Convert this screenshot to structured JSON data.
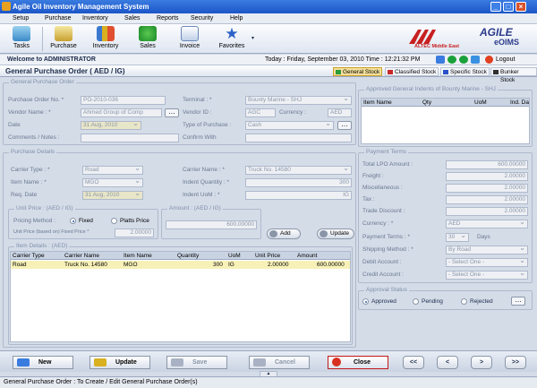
{
  "window": {
    "title": "Agile Oil Inventory Management System"
  },
  "menu": [
    "Setup",
    "Purchase",
    "Inventory",
    "Sales",
    "Reports",
    "Security",
    "Help"
  ],
  "toolbar": {
    "tasks": "Tasks",
    "purchase": "Purchase",
    "inventory": "Inventory",
    "sales": "Sales",
    "invoice": "Invoice",
    "favorites": "Favorites"
  },
  "branding": {
    "altec": "ALTEC Middle East",
    "agile": "AGILE",
    "eoims": "eOIMS",
    "logout": "Logout"
  },
  "welcome": {
    "user": "Welcome to ADMINISTRATOR",
    "datetime": "Today : Friday, September 03, 2010  Time : 12:21:32 PM"
  },
  "page": {
    "title": "General Purchase Order ( AED / IG)"
  },
  "stock_tabs": [
    {
      "label": "General Stock",
      "color": "#2a9a3a"
    },
    {
      "label": "Classified Stock",
      "color": "#c82828"
    },
    {
      "label": "Specific Stock",
      "color": "#2a50c8"
    },
    {
      "label": "Bunker Stock",
      "color": "#303030"
    }
  ],
  "gpo": {
    "section": "General Purchase Order",
    "po_no_label": "Purchase Order No. *",
    "po_no": "PO-2010-036",
    "vendor_name_label": "Vendor Name : *",
    "vendor_name": "Ahmed Group of Comp",
    "date_label": "Date",
    "date": "31 Aug, 2010",
    "comments_label": "Comments / Notes :",
    "terminal_label": "Terminal : *",
    "terminal": "Bounty Marine - SHJ",
    "vendor_id_label": "Vendor ID :",
    "vendor_id": "AGC",
    "currency_label": "Currency :",
    "currency": "AED",
    "type_label": "Type of Purchase :",
    "type": "Cash",
    "confirm_label": "Confirm With"
  },
  "pd": {
    "section": "Purchase Details",
    "carrier_type_label": "Carrier Type : *",
    "carrier_type": "Road",
    "item_name_label": "Item Name : *",
    "item_name": "MGO",
    "req_date_label": "Req. Date",
    "req_date": "31 Aug, 2010",
    "carrier_name_label": "Carrier Name : *",
    "carrier_name": "Truck No. 14580",
    "indent_qty_label": "Indent Quantity : *",
    "indent_qty": "300",
    "indent_uom_label": "Indent UoM : *",
    "indent_uom": "IG",
    "unit_price_section": "Unit Price : (AED / IG)",
    "pricing_label": "Pricing Method :",
    "fixed": "Fixed",
    "platts": "Platts Price",
    "fixed_price_label": "Unit Price (based on) Fixed Price *",
    "fixed_price": "2.00000",
    "amount_section": "Amount : (AED / IG)",
    "amount": "600.00000",
    "add": "Add",
    "update": "Update"
  },
  "items": {
    "section": "Item Details : (AED)",
    "columns": [
      "Carrier Type",
      "Carrier Name",
      "Item Name",
      "Quantity",
      "UoM",
      "Unit Price",
      "Amount"
    ],
    "rows": [
      [
        "Road",
        "Truck No. 14580",
        "MGO",
        "300",
        "IG",
        "2.00000",
        "600.00000"
      ]
    ]
  },
  "indents": {
    "section": "Approved General Indents of Bounty Marine - SHJ",
    "columns": [
      "Item Name",
      "Qty",
      "UoM",
      "Ind. Da"
    ]
  },
  "terms": {
    "section": "Payment Terms",
    "total_lpo_label": "Total LPO Amount :",
    "total_lpo": "600.00000",
    "freight_label": "Freight :",
    "freight": "2.00000",
    "misc_label": "Miscellaneous :",
    "misc": "2.00000",
    "tax_label": "Tax :",
    "tax": "2.00000",
    "trade_label": "Trade Discount :",
    "trade": "2.00000",
    "currency_label": "Currency : *",
    "currency": "AED",
    "payment_label": "Payment Terms : *",
    "payment": "30",
    "days": "Days",
    "shipping_label": "Shipping Method : *",
    "shipping": "By Road",
    "debit_label": "Debit Account :",
    "debit": "- Select One -",
    "credit_label": "Credit Account :",
    "credit": "- Select One -"
  },
  "approval": {
    "section": "Approval Status",
    "approved": "Approved",
    "pending": "Pending",
    "rejected": "Rejected"
  },
  "actions": {
    "new": "New",
    "update": "Update",
    "save": "Save",
    "cancel": "Cancel",
    "close": "Close"
  },
  "nav": {
    "first": "<<",
    "prev": "<",
    "next": ">",
    "last": ">>"
  },
  "status": {
    "text": "General Purchase Order : To Create / Edit General Purchase Order(s)"
  }
}
